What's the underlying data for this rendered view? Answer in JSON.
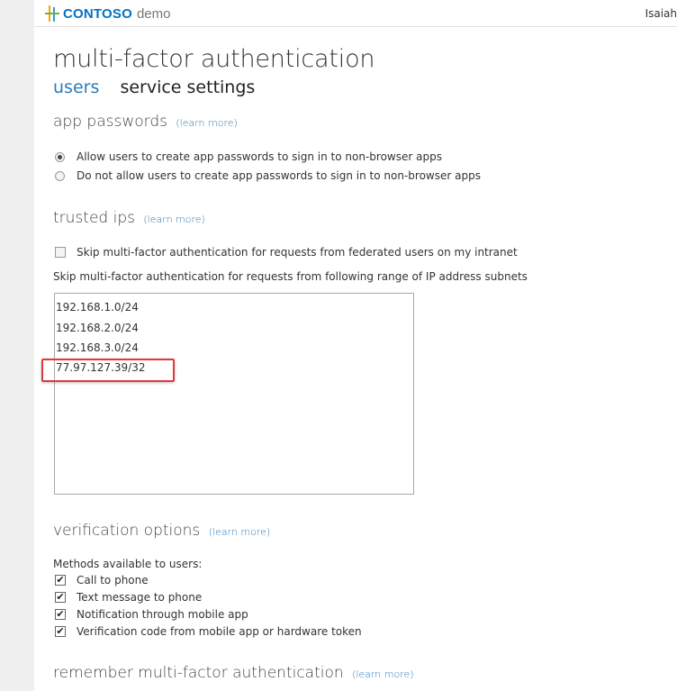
{
  "header": {
    "brand": "CONTOSO",
    "brand_suffix": "demo",
    "user_name": "Isaiah",
    "colors": {
      "brand": "#0072c6",
      "logo_bar_1": "#f2a900",
      "logo_bar_2": "#2a9fd6",
      "logo_bar_3": "#6bb33c"
    }
  },
  "page": {
    "title": "multi-factor authentication",
    "tabs": [
      {
        "label": "users",
        "active": false
      },
      {
        "label": "service settings",
        "active": true
      }
    ]
  },
  "app_passwords": {
    "title": "app passwords",
    "learn_more": "(learn more)",
    "options": [
      {
        "label": "Allow users to create app passwords to sign in to non-browser apps",
        "selected": true
      },
      {
        "label": "Do not allow users to create app passwords to sign in to non-browser apps",
        "selected": false
      }
    ]
  },
  "trusted_ips": {
    "title": "trusted ips",
    "learn_more": "(learn more)",
    "federated_checkbox": {
      "label": "Skip multi-factor authentication for requests from federated users on my intranet",
      "checked": false
    },
    "subnets_label": "Skip multi-factor authentication for requests from following range of IP address subnets",
    "subnets": [
      "192.168.1.0/24",
      "192.168.2.0/24",
      "192.168.3.0/24",
      "77.97.127.39/32"
    ],
    "highlight_color": "#e0393e"
  },
  "verification_options": {
    "title": "verification options",
    "learn_more": "(learn more)",
    "methods_label": "Methods available to users:",
    "methods": [
      {
        "label": "Call to phone",
        "checked": true
      },
      {
        "label": "Text message to phone",
        "checked": true
      },
      {
        "label": "Notification through mobile app",
        "checked": true
      },
      {
        "label": "Verification code from mobile app or hardware token",
        "checked": true
      }
    ]
  },
  "remember_mfa": {
    "title": "remember multi-factor authentication",
    "learn_more": "(learn more)"
  }
}
